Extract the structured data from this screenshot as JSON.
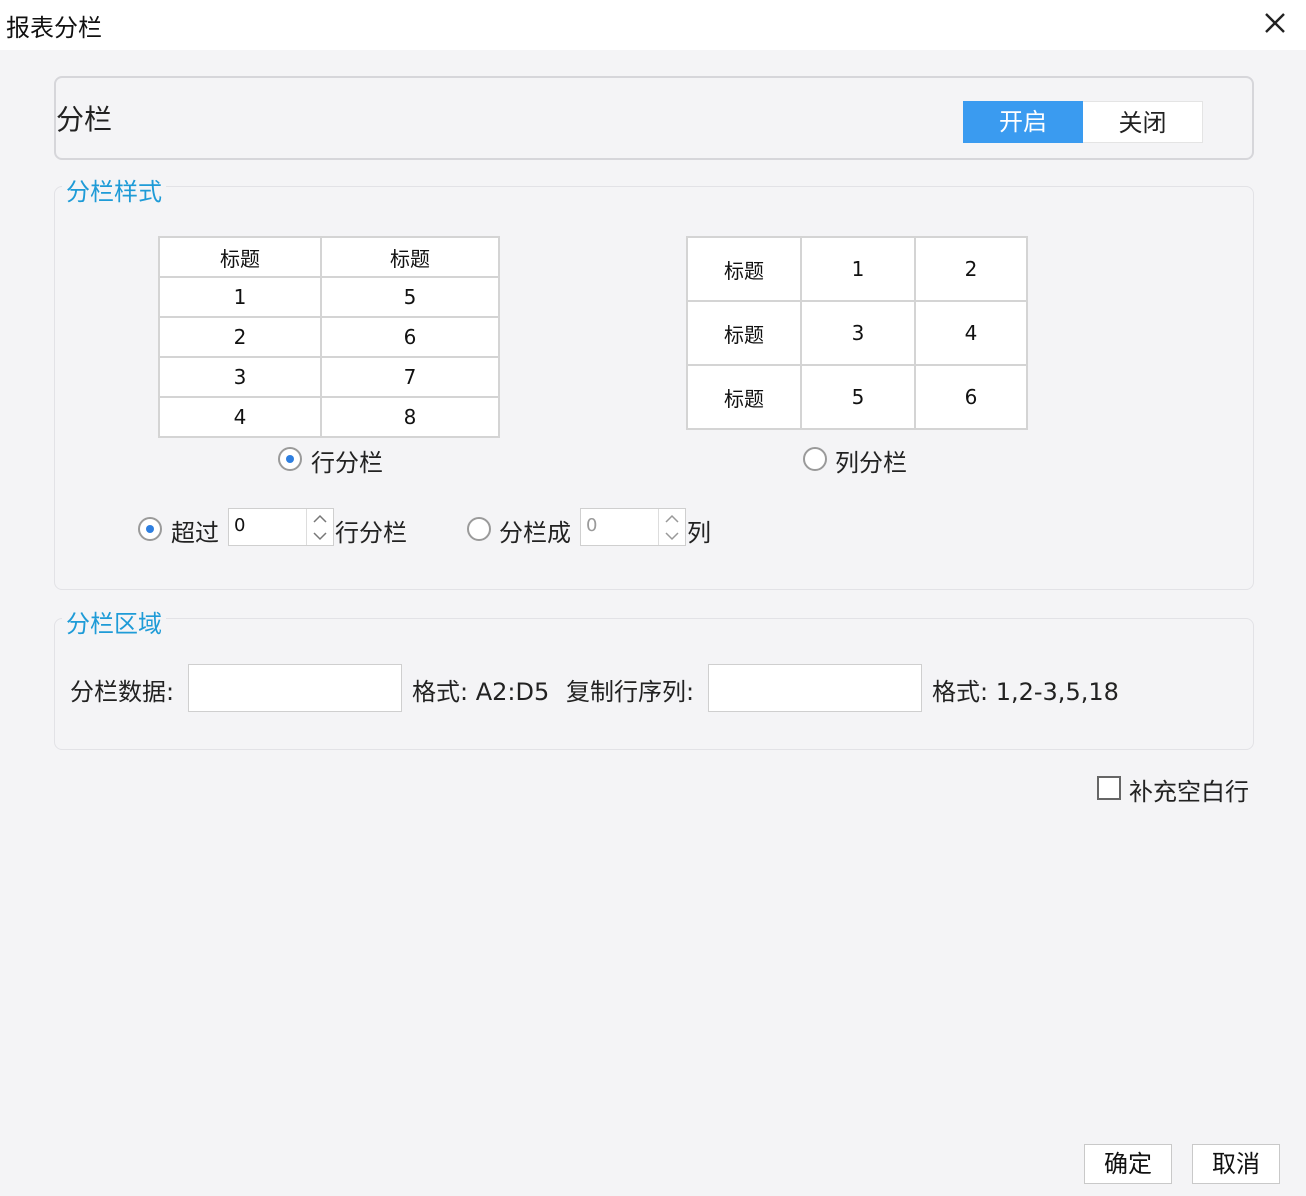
{
  "window": {
    "title": "报表分栏"
  },
  "toggle": {
    "label": "分栏",
    "on_label": "开启",
    "off_label": "关闭",
    "selected": "开启",
    "accent": "#3a9bf0"
  },
  "style_group": {
    "title": "分栏样式",
    "row_preview": {
      "headers": [
        "标题",
        "标题"
      ],
      "rows": [
        [
          "1",
          "5"
        ],
        [
          "2",
          "6"
        ],
        [
          "3",
          "7"
        ],
        [
          "4",
          "8"
        ]
      ]
    },
    "col_preview": {
      "rows": [
        [
          "标题",
          "1",
          "2"
        ],
        [
          "标题",
          "3",
          "4"
        ],
        [
          "标题",
          "5",
          "6"
        ]
      ]
    },
    "row_option_label": "行分栏",
    "col_option_label": "列分栏",
    "selected_mode": "行分栏",
    "exceed": {
      "prefix": "超过",
      "value": "0",
      "suffix": "行分栏"
    },
    "split": {
      "prefix": "分栏成",
      "value": "0",
      "suffix": "列"
    }
  },
  "area_group": {
    "title": "分栏区域",
    "data_label": "分栏数据:",
    "data_value": "",
    "data_format": "格式: A2:D5",
    "copy_label": "复制行序列:",
    "copy_value": "",
    "copy_format": "格式: 1,2-3,5,18"
  },
  "fill_blank": {
    "label": "补充空白行",
    "checked": false
  },
  "buttons": {
    "ok": "确定",
    "cancel": "取消"
  }
}
